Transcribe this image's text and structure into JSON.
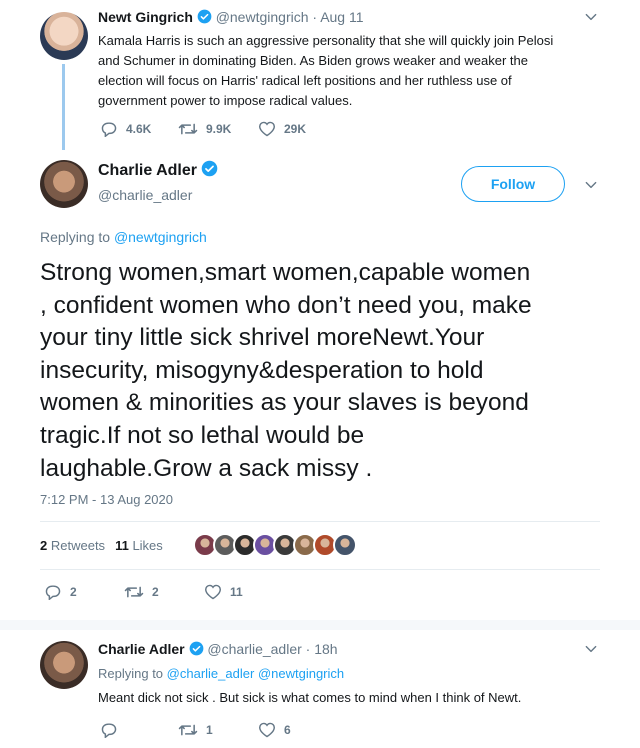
{
  "parent_tweet": {
    "name": "Newt Gingrich",
    "handle": "@newtgingrich",
    "separator": "·",
    "date": "Aug 11",
    "text_line1": "Kamala Harris is such an aggressive personality  that she will quickly join Pelosi",
    "text_line2": "and Schumer in dominating Biden. As Biden grows weaker and weaker the",
    "text_line3": "election will focus on Harris' radical left positions and her ruthless use of",
    "text_line4": "government power to impose radical values.",
    "replies": "4.6K",
    "retweets": "9.9K",
    "likes": "29K"
  },
  "main_tweet": {
    "name": "Charlie Adler",
    "handle": "@charlie_adler",
    "follow_label": "Follow",
    "replying_prefix": "Replying to",
    "replying_handle": "@newtgingrich",
    "text_line1": "Strong women,smart women,capable women",
    "text_line2": ", confident women who don’t need you, make",
    "text_line3": "your tiny little sick shrivel moreNewt.Your",
    "text_line4": "insecurity, misogyny&desperation to hold",
    "text_line5": "women & minorities as your slaves is beyond",
    "text_line6": "tragic.If not so lethal would be",
    "text_line7": "laughable.Grow a sack missy .",
    "timestamp": "7:12 PM - 13 Aug 2020",
    "retweet_count": "2",
    "retweet_label": "Retweets",
    "like_count": "11",
    "like_label": "Likes",
    "liker_colors": [
      "#7a3b4a",
      "#5c5c5c",
      "#2b2b2b",
      "#6a4fa0",
      "#3a3a3a",
      "#8a6a4a",
      "#b04a2a",
      "#44546a"
    ],
    "replies": "2",
    "retweets": "2",
    "likes": "11"
  },
  "reply_tweet": {
    "name": "Charlie Adler",
    "handle": "@charlie_adler",
    "separator": "·",
    "date": "18h",
    "replying_prefix": "Replying to",
    "replying_handle1": "@charlie_adler",
    "replying_handle2": "@newtgingrich",
    "text": "Meant dick not sick . But sick is what comes to mind when I think of Newt.",
    "retweets": "1",
    "likes": "6"
  },
  "colors": {
    "accent": "#1da1f2",
    "text": "#14171a",
    "muted": "#657786",
    "thread_line": "#ccd6dd"
  }
}
